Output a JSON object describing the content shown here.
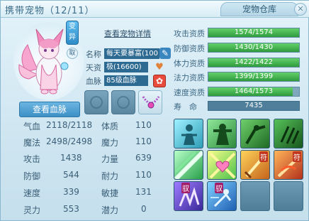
{
  "header": {
    "title": "携带宠物（12/11）",
    "storage_tab": "宠物仓库",
    "close": "✕"
  },
  "pet": {
    "variant_badge": "变异",
    "take_badge": "取",
    "view_bloodline_btn": "查看血脉",
    "detail_link": "查看宠物详情",
    "name_label": "名称",
    "name_value": "每天要暴富(100",
    "talent_label": "天资",
    "talent_value": "极(16600)",
    "blood_label": "血脉",
    "blood_value": "85级血脉"
  },
  "stats": {
    "qixue_label": "气血",
    "qixue_value": "2118/2118",
    "tizhi_label": "体质",
    "tizhi_value": "110",
    "mofa_label": "魔法",
    "mofa_value": "2498/2498",
    "moli_label": "魔力",
    "moli_value": "110",
    "gongji_label": "攻击",
    "gongji_value": "1438",
    "liliang_label": "力量",
    "liliang_value": "639",
    "fangyu_label": "防御",
    "fangyu_value": "544",
    "naili_label": "耐力",
    "naili_value": "110",
    "sudu_label": "速度",
    "sudu_value": "339",
    "minjie_label": "敏捷",
    "minjie_value": "131",
    "lingli_label": "灵力",
    "lingli_value": "553",
    "qianli_label": "潜力",
    "qianli_value": "0"
  },
  "aptitudes": [
    {
      "label": "攻击资质",
      "value": "1574/1574",
      "fill": 1.0
    },
    {
      "label": "防御资质",
      "value": "1430/1430",
      "fill": 1.0
    },
    {
      "label": "体力资质",
      "value": "1422/1422",
      "fill": 1.0
    },
    {
      "label": "法力资质",
      "value": "1399/1399",
      "fill": 1.0
    },
    {
      "label": "速度资质",
      "value": "1464/1573",
      "fill": 0.93
    }
  ],
  "life": {
    "label": "寿　命",
    "value": "7435"
  },
  "skills": {
    "badge_fu": "符",
    "badge_yu": "驭"
  }
}
